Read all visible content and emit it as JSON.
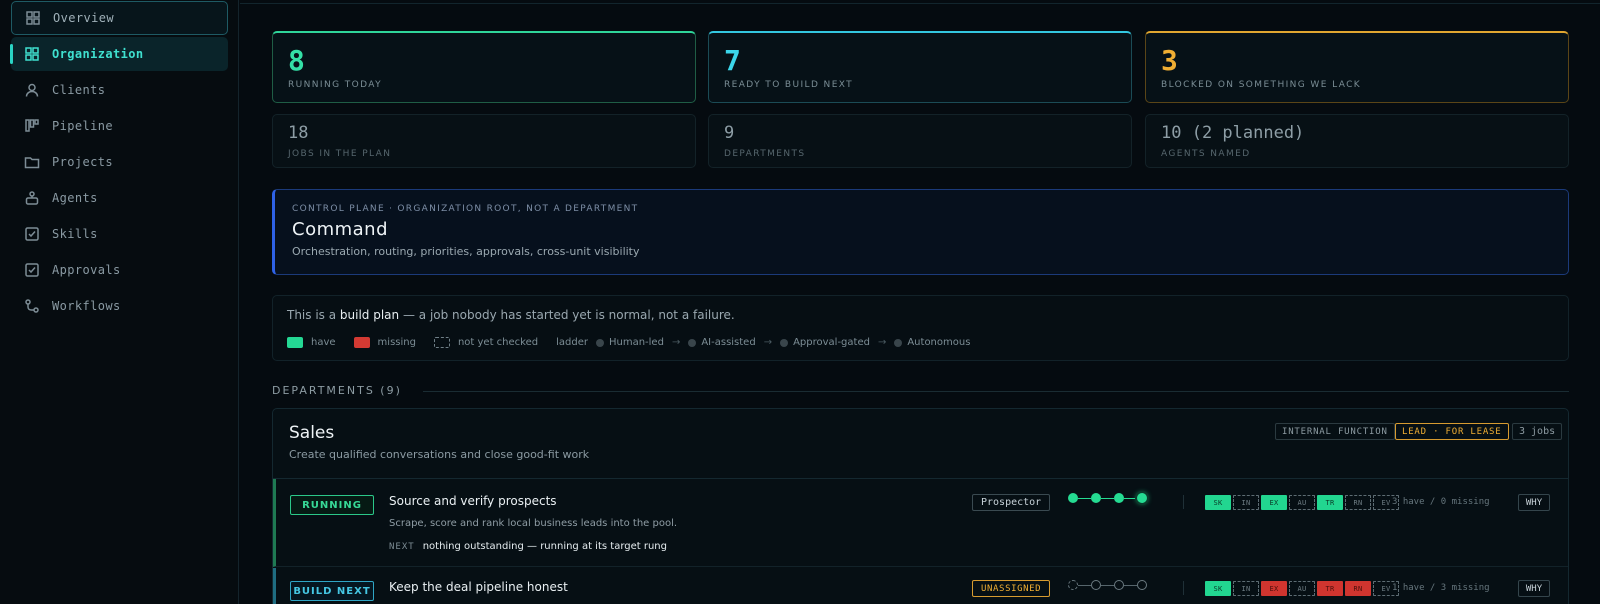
{
  "sidebar": {
    "items": [
      {
        "label": "Overview",
        "icon": "grid-icon"
      },
      {
        "label": "Organization",
        "icon": "grid-icon"
      },
      {
        "label": "Clients",
        "icon": "user-icon"
      },
      {
        "label": "Pipeline",
        "icon": "kanban-icon"
      },
      {
        "label": "Projects",
        "icon": "folder-icon"
      },
      {
        "label": "Agents",
        "icon": "bot-icon"
      },
      {
        "label": "Skills",
        "icon": "checkbox-icon"
      },
      {
        "label": "Approvals",
        "icon": "checkbox-icon"
      },
      {
        "label": "Workflows",
        "icon": "workflow-icon"
      }
    ],
    "active_index": 1
  },
  "stats": {
    "running": {
      "value": "8",
      "label": "RUNNING TODAY"
    },
    "ready": {
      "value": "7",
      "label": "READY TO BUILD NEXT"
    },
    "blocked": {
      "value": "3",
      "label": "BLOCKED ON SOMETHING WE LACK"
    },
    "jobs": {
      "value": "18",
      "label": "JOBS IN THE PLAN"
    },
    "departments": {
      "value": "9",
      "label": "DEPARTMENTS"
    },
    "agents": {
      "value": "10 (2 planned)",
      "label": "AGENTS NAMED"
    }
  },
  "command": {
    "kicker": "CONTROL PLANE · ORGANIZATION ROOT, NOT A DEPARTMENT",
    "title": "Command",
    "desc": "Orchestration, routing, priorities, approvals, cross-unit visibility"
  },
  "legend": {
    "intro_pre": "This is a ",
    "intro_bold": "build plan",
    "intro_post": " — a job nobody has started yet is normal, not a failure.",
    "have": "have",
    "missing": "missing",
    "unchecked": "not yet checked",
    "ladder_label": "ladder",
    "rungs": [
      "Human-led",
      "AI-assisted",
      "Approval-gated",
      "Autonomous"
    ]
  },
  "departments_header": "DEPARTMENTS (9)",
  "department": {
    "name": "Sales",
    "subtitle": "Create qualified conversations and close good-fit work",
    "tags": {
      "function": "INTERNAL FUNCTION",
      "lead": "LEAD · FOR LEASE",
      "jobs": "3 jobs"
    },
    "jobs": [
      {
        "status": "RUNNING",
        "title": "Source and verify prospects",
        "desc": "Scrape, score and rank local business leads into the pool.",
        "next_label": "NEXT",
        "next": "nothing outstanding — running at its target rung",
        "agent": "Prospector",
        "caps": [
          {
            "code": "SK",
            "state": "have"
          },
          {
            "code": "IN",
            "state": "unchecked"
          },
          {
            "code": "EX",
            "state": "have"
          },
          {
            "code": "AU",
            "state": "unchecked"
          },
          {
            "code": "TR",
            "state": "have"
          },
          {
            "code": "RN",
            "state": "unchecked"
          },
          {
            "code": "EV",
            "state": "unchecked"
          }
        ],
        "cap_count": "3 have / 0 missing",
        "why": "WHY"
      },
      {
        "status": "BUILD NEXT",
        "title": "Keep the deal pipeline honest",
        "agent": "UNASSIGNED",
        "caps": [
          {
            "code": "SK",
            "state": "have"
          },
          {
            "code": "IN",
            "state": "unchecked"
          },
          {
            "code": "EX",
            "state": "missing"
          },
          {
            "code": "AU",
            "state": "unchecked"
          },
          {
            "code": "TR",
            "state": "missing"
          },
          {
            "code": "RN",
            "state": "missing"
          },
          {
            "code": "EV",
            "state": "unchecked"
          }
        ],
        "cap_count": "1 have / 3 missing",
        "why": "WHY"
      }
    ]
  }
}
